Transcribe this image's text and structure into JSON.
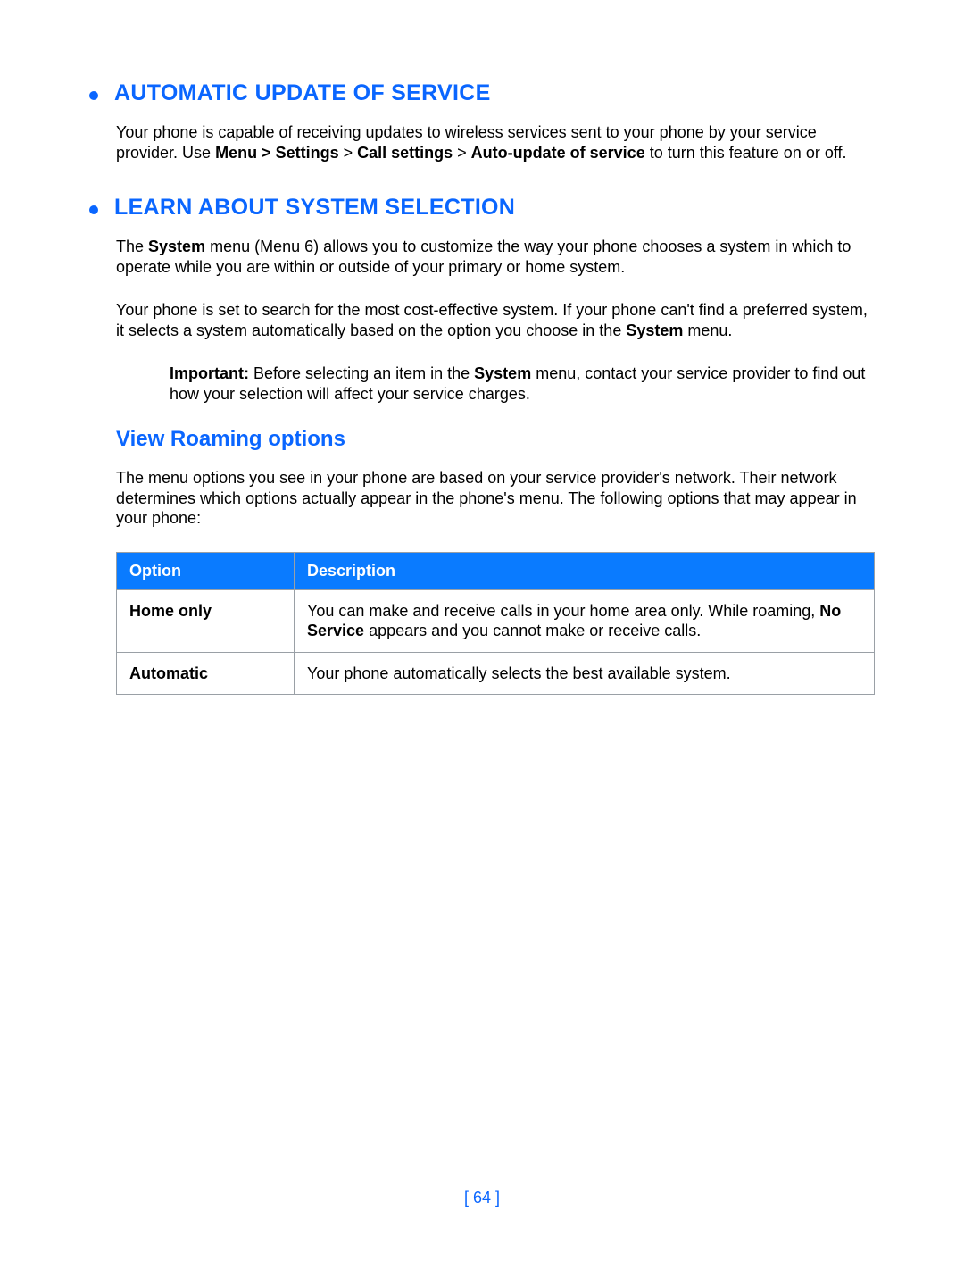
{
  "sections": [
    {
      "title": "AUTOMATIC UPDATE OF SERVICE",
      "para1_pre": "Your phone is capable of receiving updates to wireless services sent to your phone by your service provider. Use ",
      "para1_bold1": "Menu > Settings",
      "para1_mid1": " > ",
      "para1_bold2": "Call settings",
      "para1_mid2": " > ",
      "para1_bold3": "Auto-update of service",
      "para1_post": " to turn this feature on or off."
    },
    {
      "title": "LEARN ABOUT SYSTEM SELECTION",
      "para1_pre": "The ",
      "para1_bold1": "System",
      "para1_post": " menu (Menu 6) allows you to customize the way your phone chooses a system in which to operate while you are within or outside of your primary or home system.",
      "para2_pre": "Your phone is set to search for the most cost-effective system. If your phone can't find a preferred system, it selects a system automatically based on the option you choose in the ",
      "para2_bold1": "System",
      "para2_post": " menu.",
      "note_label": "Important:",
      "note_pre": " Before selecting an item in the ",
      "note_bold1": "System",
      "note_post": " menu, contact your service provider to find out how your selection will affect your service charges."
    }
  ],
  "subheading": "View Roaming options",
  "subpara": "The menu options you see in your phone are based on your service provider's network. Their network determines which options actually appear in the phone's menu. The following options that may appear in your phone:",
  "table": {
    "headers": {
      "option": "Option",
      "description": "Description"
    },
    "rows": [
      {
        "option": "Home only",
        "desc_pre": "You can make and receive calls in your home area only. While roaming, ",
        "desc_bold": "No Service",
        "desc_post": " appears and you cannot make or receive calls."
      },
      {
        "option": "Automatic",
        "desc_pre": "Your phone automatically selects the best available system.",
        "desc_bold": "",
        "desc_post": ""
      }
    ]
  },
  "page_number": "[ 64 ]"
}
